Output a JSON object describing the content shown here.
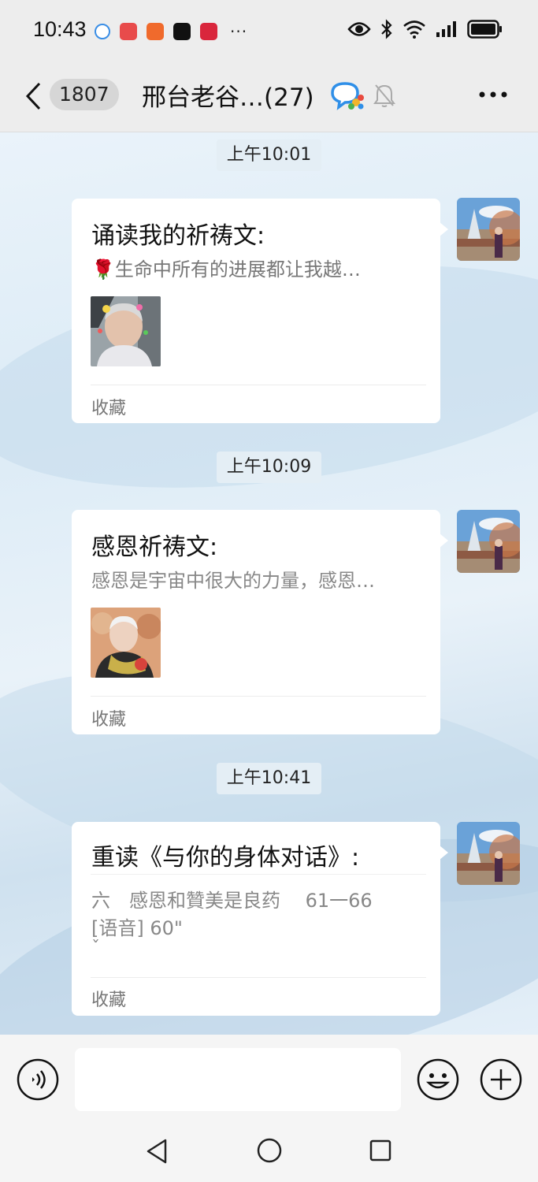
{
  "status_bar": {
    "time": "10:43",
    "overflow": "···",
    "icons": [
      "wechat-icon",
      "huawei-icon",
      "app-icon",
      "tiktok-icon",
      "heart-app-icon",
      "eye-icon",
      "bluetooth-icon",
      "wifi-icon",
      "signal-icon",
      "battery-icon"
    ]
  },
  "header": {
    "unread_count": "1807",
    "title": "邢台老谷…(27)",
    "icons": [
      "back-icon",
      "group-chat-icon",
      "mute-icon",
      "more-icon"
    ]
  },
  "messages": [
    {
      "timestamp": "上午10:01",
      "title": "诵读我的祈祷文:",
      "description": "🌹生命中所有的进展都让我越…",
      "favorite_label": "收藏"
    },
    {
      "timestamp": "上午10:09",
      "title": "感恩祈祷文:",
      "description": "感恩是宇宙中很大的力量，感恩…",
      "favorite_label": "收藏"
    },
    {
      "timestamp": "上午10:41",
      "title": "重读《与你的身体对话》:",
      "description_line1": "六　感恩和贊美是良药　 61一66",
      "description_line2": "[语音] 60\"",
      "description_line3": "ˇ",
      "favorite_label": "收藏"
    }
  ],
  "input_bar": {
    "placeholder": "",
    "icons": [
      "voice-icon",
      "emoji-icon",
      "plus-icon"
    ]
  },
  "nav_bar": {
    "icons": [
      "nav-back-icon",
      "nav-home-icon",
      "nav-recent-icon"
    ]
  },
  "colors": {
    "bubble": "#ffffff",
    "chat_background": "#dcebf6",
    "timestamp_bg": "#e4eef5",
    "header_bg": "#ededed"
  }
}
